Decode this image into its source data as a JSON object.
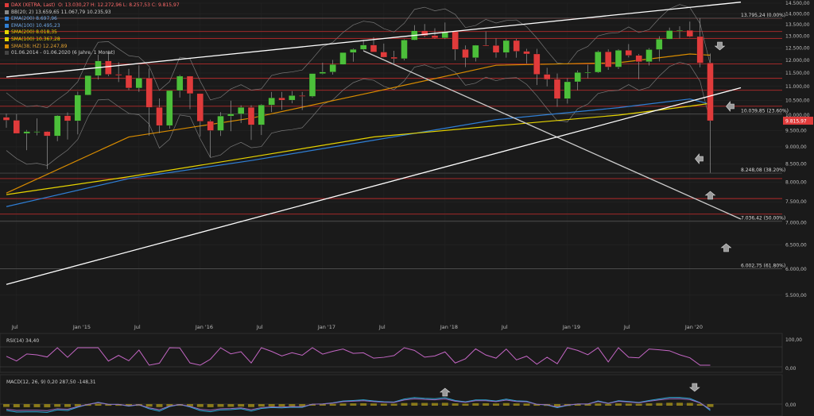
{
  "header": {
    "instrument": "DAX (XETRA, Last)",
    "ohlc": "O: 13.030,27   H: 12.272,96   L: 8.257,53   C: 9.815,97"
  },
  "legend": [
    {
      "text": "BB(20; 2)   13.659,65   11.067,79   10.235,93",
      "color": "#888888"
    },
    {
      "text": "EMA(200)   8.697,96",
      "color": "#2f7fd6"
    },
    {
      "text": "EMA(100)   10.495,23",
      "color": "#2f7fd6"
    },
    {
      "text": "SMA(200)   8.018,35",
      "color": "#e6d400"
    },
    {
      "text": "SMA(100)   10.367,28",
      "color": "#e6d400"
    },
    {
      "text": "SMA(38; HZ)   12.247,89",
      "color": "#d98c00"
    },
    {
      "text": "01.06.2014 - 01.06.2020   (6 Jahre, 1 Monat)",
      "color": "#cccccc"
    }
  ],
  "colors": {
    "background": "#1a1a1a",
    "up": "#4cbf3a",
    "down": "#e03b3b",
    "ema": "#2f7fd6",
    "sma200": "#e6d400",
    "sma100": "#c9a000",
    "sma38": "#d98c00",
    "bb": "#777777",
    "hline": "#b42a2a",
    "rsi": "#c466c4",
    "macd": "#2fa8d6",
    "macd_signal": "#9a6cc0",
    "macd_hist": "#8a7a1a"
  },
  "last_price_label": "9.815,97",
  "chart_data": {
    "type": "candlestick",
    "title": "DAX (XETRA, Last)",
    "interval": "monthly",
    "x_range": [
      "2014-06",
      "2020-06"
    ],
    "ylim": [
      5000,
      14500
    ],
    "y_scale": "log",
    "y_ticks": [
      "14.500,00",
      "14.000,00",
      "13.500,00",
      "13.000,00",
      "12.500,00",
      "12.000,00",
      "11.500,00",
      "11.000,00",
      "10.500,00",
      "10.000,00",
      "9.500,00",
      "9.000,00",
      "8.500,00",
      "8.000,00",
      "7.500,00",
      "7.000,00",
      "6.500,00",
      "6.000,00",
      "5.500,00"
    ],
    "y_tick_values": [
      14500,
      14000,
      13500,
      13000,
      12500,
      12000,
      11500,
      11000,
      10500,
      10000,
      9500,
      9000,
      8500,
      8000,
      7500,
      7000,
      6500,
      6000,
      5500
    ],
    "x_ticks": [
      {
        "label": "Jul",
        "date": "2014-07"
      },
      {
        "label": "Jan '15",
        "date": "2015-01"
      },
      {
        "label": "Jul",
        "date": "2015-07"
      },
      {
        "label": "Jan '16",
        "date": "2016-01"
      },
      {
        "label": "Jul",
        "date": "2016-07"
      },
      {
        "label": "Jan '17",
        "date": "2017-01"
      },
      {
        "label": "Jul",
        "date": "2017-07"
      },
      {
        "label": "Jan '18",
        "date": "2018-01"
      },
      {
        "label": "Jul",
        "date": "2018-07"
      },
      {
        "label": "Jan '19",
        "date": "2019-01"
      },
      {
        "label": "Jul",
        "date": "2019-07"
      },
      {
        "label": "Jan '20",
        "date": "2020-01"
      }
    ],
    "fib_levels": [
      {
        "value": 13795.24,
        "label": "13.795,24 (0.00%)"
      },
      {
        "value": 10039.85,
        "label": "10.039,85 (23.60%)"
      },
      {
        "value": 8248.08,
        "label": "8.248,08 (38.20%)"
      },
      {
        "value": 7036.42,
        "label": "7.036,42 (50.00%)"
      },
      {
        "value": 6002.75,
        "label": "6.002,75 (61.80%)"
      }
    ],
    "horizontal_lines": [
      13795,
      13200,
      12900,
      11850,
      11300,
      10860,
      10300,
      8100,
      7580,
      7200
    ],
    "candles": [
      {
        "date": "2014-06",
        "o": 9930,
        "h": 10050,
        "l": 9590,
        "c": 9830
      },
      {
        "date": "2014-07",
        "o": 9830,
        "h": 10030,
        "l": 9410,
        "c": 9410
      },
      {
        "date": "2014-08",
        "o": 9410,
        "h": 9520,
        "l": 8900,
        "c": 9470
      },
      {
        "date": "2014-09",
        "o": 9470,
        "h": 9890,
        "l": 9350,
        "c": 9470
      },
      {
        "date": "2014-10",
        "o": 9470,
        "h": 9480,
        "l": 8360,
        "c": 9330
      },
      {
        "date": "2014-11",
        "o": 9330,
        "h": 10000,
        "l": 9170,
        "c": 9980
      },
      {
        "date": "2014-12",
        "o": 9980,
        "h": 10090,
        "l": 9220,
        "c": 9810
      },
      {
        "date": "2015-01",
        "o": 9810,
        "h": 10810,
        "l": 9380,
        "c": 10690
      },
      {
        "date": "2015-02",
        "o": 10690,
        "h": 11400,
        "l": 10680,
        "c": 11400
      },
      {
        "date": "2015-03",
        "o": 11400,
        "h": 12220,
        "l": 11250,
        "c": 11970
      },
      {
        "date": "2015-04",
        "o": 11970,
        "h": 12390,
        "l": 11380,
        "c": 11450
      },
      {
        "date": "2015-05",
        "o": 11450,
        "h": 11920,
        "l": 11160,
        "c": 11410
      },
      {
        "date": "2015-06",
        "o": 11410,
        "h": 11660,
        "l": 10870,
        "c": 10940
      },
      {
        "date": "2015-07",
        "o": 10940,
        "h": 11800,
        "l": 10800,
        "c": 11310
      },
      {
        "date": "2015-08",
        "o": 11310,
        "h": 11670,
        "l": 9340,
        "c": 10260
      },
      {
        "date": "2015-09",
        "o": 10260,
        "h": 10570,
        "l": 9420,
        "c": 9660
      },
      {
        "date": "2015-10",
        "o": 9660,
        "h": 10850,
        "l": 9560,
        "c": 10850
      },
      {
        "date": "2015-11",
        "o": 10850,
        "h": 11430,
        "l": 10600,
        "c": 11380
      },
      {
        "date": "2015-12",
        "o": 11380,
        "h": 11380,
        "l": 10200,
        "c": 10740
      },
      {
        "date": "2016-01",
        "o": 10740,
        "h": 10740,
        "l": 9310,
        "c": 9800
      },
      {
        "date": "2016-02",
        "o": 9800,
        "h": 9850,
        "l": 8700,
        "c": 9500
      },
      {
        "date": "2016-03",
        "o": 9500,
        "h": 10100,
        "l": 9330,
        "c": 9970
      },
      {
        "date": "2016-04",
        "o": 9970,
        "h": 10490,
        "l": 9480,
        "c": 10040
      },
      {
        "date": "2016-05",
        "o": 10040,
        "h": 10330,
        "l": 9740,
        "c": 10260
      },
      {
        "date": "2016-06",
        "o": 10260,
        "h": 10330,
        "l": 9210,
        "c": 9680
      },
      {
        "date": "2016-07",
        "o": 9680,
        "h": 10370,
        "l": 9360,
        "c": 10340
      },
      {
        "date": "2016-08",
        "o": 10340,
        "h": 10800,
        "l": 10100,
        "c": 10590
      },
      {
        "date": "2016-09",
        "o": 10590,
        "h": 10800,
        "l": 10180,
        "c": 10510
      },
      {
        "date": "2016-10",
        "o": 10510,
        "h": 10830,
        "l": 10400,
        "c": 10670
      },
      {
        "date": "2016-11",
        "o": 10670,
        "h": 10800,
        "l": 10170,
        "c": 10640
      },
      {
        "date": "2016-12",
        "o": 10640,
        "h": 11480,
        "l": 10600,
        "c": 11480
      },
      {
        "date": "2017-01",
        "o": 11480,
        "h": 11900,
        "l": 11450,
        "c": 11540
      },
      {
        "date": "2017-02",
        "o": 11540,
        "h": 12010,
        "l": 11440,
        "c": 11830
      },
      {
        "date": "2017-03",
        "o": 11830,
        "h": 12260,
        "l": 11820,
        "c": 12310
      },
      {
        "date": "2017-04",
        "o": 12310,
        "h": 12480,
        "l": 11940,
        "c": 12440
      },
      {
        "date": "2017-05",
        "o": 12440,
        "h": 12840,
        "l": 12400,
        "c": 12620
      },
      {
        "date": "2017-06",
        "o": 12620,
        "h": 12950,
        "l": 12380,
        "c": 12330
      },
      {
        "date": "2017-07",
        "o": 12330,
        "h": 12680,
        "l": 12110,
        "c": 12120
      },
      {
        "date": "2017-08",
        "o": 12120,
        "h": 12380,
        "l": 11870,
        "c": 12060
      },
      {
        "date": "2017-09",
        "o": 12060,
        "h": 12860,
        "l": 11990,
        "c": 12830
      },
      {
        "date": "2017-10",
        "o": 12830,
        "h": 13480,
        "l": 12820,
        "c": 13230
      },
      {
        "date": "2017-11",
        "o": 13230,
        "h": 13530,
        "l": 12960,
        "c": 13020
      },
      {
        "date": "2017-12",
        "o": 13020,
        "h": 13340,
        "l": 12880,
        "c": 12920
      },
      {
        "date": "2018-01",
        "o": 12920,
        "h": 13600,
        "l": 12870,
        "c": 13190
      },
      {
        "date": "2018-02",
        "o": 13190,
        "h": 13200,
        "l": 12000,
        "c": 12440
      },
      {
        "date": "2018-03",
        "o": 12440,
        "h": 12600,
        "l": 11730,
        "c": 12100
      },
      {
        "date": "2018-04",
        "o": 12100,
        "h": 12620,
        "l": 11950,
        "c": 12610
      },
      {
        "date": "2018-05",
        "o": 12610,
        "h": 13200,
        "l": 12580,
        "c": 12600
      },
      {
        "date": "2018-06",
        "o": 12600,
        "h": 12900,
        "l": 12100,
        "c": 12310
      },
      {
        "date": "2018-07",
        "o": 12310,
        "h": 12880,
        "l": 12100,
        "c": 12810
      },
      {
        "date": "2018-08",
        "o": 12810,
        "h": 12880,
        "l": 12100,
        "c": 12360
      },
      {
        "date": "2018-09",
        "o": 12360,
        "h": 12460,
        "l": 11870,
        "c": 12250
      },
      {
        "date": "2018-10",
        "o": 12250,
        "h": 12460,
        "l": 11050,
        "c": 11450
      },
      {
        "date": "2018-11",
        "o": 11450,
        "h": 11700,
        "l": 11000,
        "c": 11260
      },
      {
        "date": "2018-12",
        "o": 11260,
        "h": 11480,
        "l": 10280,
        "c": 10560
      },
      {
        "date": "2019-01",
        "o": 10560,
        "h": 11300,
        "l": 10390,
        "c": 11170
      },
      {
        "date": "2019-02",
        "o": 11170,
        "h": 11600,
        "l": 10860,
        "c": 11520
      },
      {
        "date": "2019-03",
        "o": 11520,
        "h": 11820,
        "l": 11300,
        "c": 11530
      },
      {
        "date": "2019-04",
        "o": 11530,
        "h": 12390,
        "l": 11500,
        "c": 12340
      },
      {
        "date": "2019-05",
        "o": 12340,
        "h": 12440,
        "l": 11620,
        "c": 11730
      },
      {
        "date": "2019-06",
        "o": 11730,
        "h": 12440,
        "l": 11650,
        "c": 12400
      },
      {
        "date": "2019-07",
        "o": 12400,
        "h": 12660,
        "l": 12110,
        "c": 12190
      },
      {
        "date": "2019-08",
        "o": 12190,
        "h": 12250,
        "l": 11270,
        "c": 11940
      },
      {
        "date": "2019-09",
        "o": 11940,
        "h": 12490,
        "l": 11790,
        "c": 12430
      },
      {
        "date": "2019-10",
        "o": 12430,
        "h": 12990,
        "l": 11950,
        "c": 12870
      },
      {
        "date": "2019-11",
        "o": 12870,
        "h": 13370,
        "l": 12860,
        "c": 13240
      },
      {
        "date": "2019-12",
        "o": 13240,
        "h": 13430,
        "l": 12900,
        "c": 13250
      },
      {
        "date": "2020-01",
        "o": 13250,
        "h": 13640,
        "l": 12950,
        "c": 12980
      },
      {
        "date": "2020-02",
        "o": 12980,
        "h": 13795,
        "l": 11720,
        "c": 11890
      },
      {
        "date": "2020-03",
        "o": 11890,
        "h": 12270,
        "l": 8257,
        "c": 9816
      }
    ],
    "overlay_series": [
      {
        "name": "EMA(200)",
        "color": "#2f7fd6",
        "points": [
          [
            "2014-06",
            7380
          ],
          [
            "2015-06",
            8100
          ],
          [
            "2016-06",
            8600
          ],
          [
            "2017-06",
            9200
          ],
          [
            "2018-06",
            9850
          ],
          [
            "2019-06",
            10250
          ],
          [
            "2020-01",
            10550
          ],
          [
            "2020-03",
            10370
          ]
        ]
      },
      {
        "name": "SMA(200)",
        "color": "#e6d400",
        "points": [
          [
            "2014-06",
            7680
          ],
          [
            "2015-06",
            8150
          ],
          [
            "2016-06",
            8700
          ],
          [
            "2017-06",
            9300
          ],
          [
            "2018-06",
            9650
          ],
          [
            "2019-06",
            10000
          ],
          [
            "2020-01",
            10300
          ],
          [
            "2020-03",
            10400
          ]
        ]
      },
      {
        "name": "SMA(38; HZ)",
        "color": "#d98c00",
        "points": [
          [
            "2014-06",
            7720
          ],
          [
            "2015-06",
            9300
          ],
          [
            "2016-06",
            9900
          ],
          [
            "2017-06",
            10800
          ],
          [
            "2018-06",
            11800
          ],
          [
            "2019-06",
            11900
          ],
          [
            "2020-01",
            12250
          ],
          [
            "2020-03",
            12200
          ]
        ]
      }
    ],
    "trend_lines": [
      {
        "from": [
          "2014-06",
          11350
        ],
        "to": [
          "2020-06",
          14550
        ],
        "color": "#ffffff"
      },
      {
        "from": [
          "2017-05",
          12380
        ],
        "to": [
          "2020-06",
          7080
        ],
        "color": "#cccccc"
      },
      {
        "from": [
          "2014-06",
          5700
        ],
        "to": [
          "2020-06",
          10950
        ],
        "color": "#ffffff"
      }
    ],
    "indicators": [
      {
        "name": "RSI(14)",
        "value_label": "RSI(14)   34,40",
        "ticks": [
          "100,00",
          "0,00"
        ]
      },
      {
        "name": "MACD(12; 26; 9)",
        "value_label": "MACD(12, 26, 9)   0,20   287,50   -148,31",
        "ticks": [
          "0,00"
        ]
      }
    ]
  }
}
